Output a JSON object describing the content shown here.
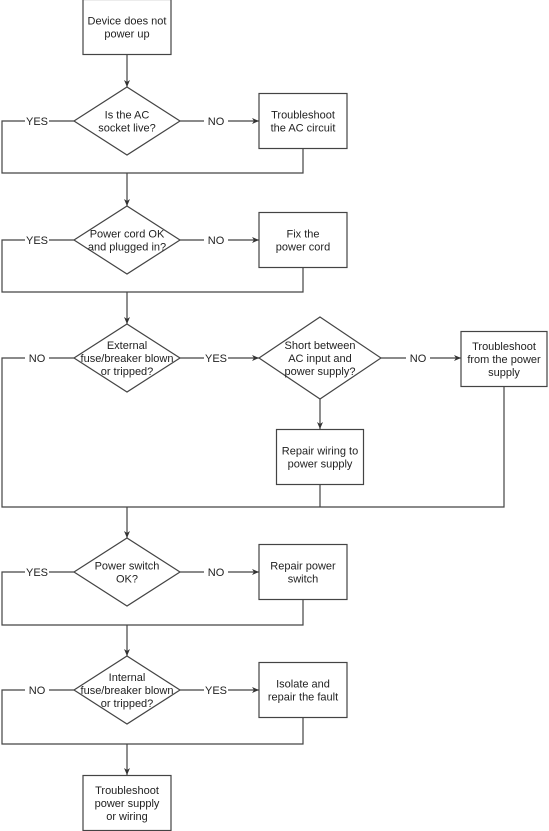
{
  "nodes": {
    "start": [
      "Device does not",
      "power up"
    ],
    "q_ac_socket": [
      "Is the AC",
      "socket live?"
    ],
    "fix_ac_circuit": [
      "Troubleshoot",
      "the AC circuit"
    ],
    "q_power_cord": [
      "Power cord OK",
      "and plugged in?"
    ],
    "fix_power_cord": [
      "Fix the",
      "power cord"
    ],
    "q_external_fuse": [
      "External",
      "fuse/breaker blown",
      "or tripped?"
    ],
    "q_short": [
      "Short between",
      "AC input and",
      "power supply?"
    ],
    "troubleshoot_psu": [
      "Troubleshoot",
      "from the power",
      "supply"
    ],
    "repair_wiring": [
      "Repair wiring to",
      "power supply"
    ],
    "q_power_switch": [
      "Power switch",
      "OK?"
    ],
    "repair_switch": [
      "Repair power",
      "switch"
    ],
    "q_internal_fuse": [
      "Internal",
      "fuse/breaker blown",
      "or tripped?"
    ],
    "isolate_fault": [
      "Isolate and",
      "repair the fault"
    ],
    "end": [
      "Troubleshoot",
      "power supply",
      "or wiring"
    ]
  },
  "labels": {
    "q_ac_socket_left": "YES",
    "q_ac_socket_right": "NO",
    "q_power_cord_left": "YES",
    "q_power_cord_right": "NO",
    "q_external_fuse_left": "NO",
    "q_external_fuse_right": "YES",
    "q_short_right": "NO",
    "q_power_switch_left": "YES",
    "q_power_switch_right": "NO",
    "q_internal_fuse_left": "NO",
    "q_internal_fuse_right": "YES"
  }
}
